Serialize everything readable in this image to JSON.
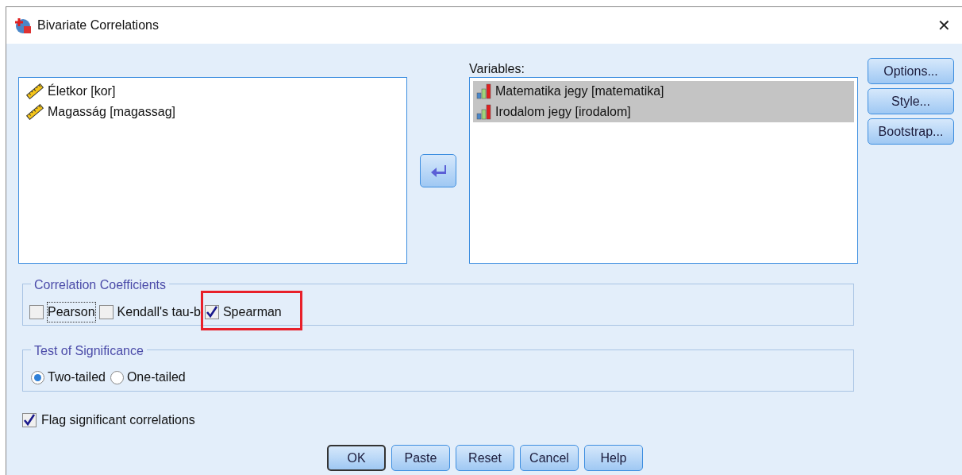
{
  "window": {
    "title": "Bivariate Correlations",
    "close": "✕"
  },
  "source_list": {
    "items": [
      {
        "label": "Életkor [kor]",
        "kind": "scale",
        "selected": false
      },
      {
        "label": "Magasság [magassag]",
        "kind": "scale",
        "selected": false
      }
    ]
  },
  "variables": {
    "label": "Variables:",
    "items": [
      {
        "label": "Matematika jegy [matematika]",
        "kind": "ordinal",
        "selected": true
      },
      {
        "label": "Irodalom jegy [irodalom]",
        "kind": "ordinal",
        "selected": true
      }
    ]
  },
  "side_buttons": [
    "Options...",
    "Style...",
    "Bootstrap..."
  ],
  "correlation_coefficients": {
    "title": "Correlation Coefficients",
    "options": [
      {
        "label": "Pearson",
        "checked": false,
        "focused": true,
        "highlighted": false
      },
      {
        "label": "Kendall's tau-b",
        "checked": false,
        "focused": false,
        "highlighted": false
      },
      {
        "label": "Spearman",
        "checked": true,
        "focused": false,
        "highlighted": true
      }
    ]
  },
  "test_of_significance": {
    "title": "Test of Significance",
    "options": [
      {
        "label": "Two-tailed",
        "selected": true
      },
      {
        "label": "One-tailed",
        "selected": false
      }
    ]
  },
  "flag_significant": {
    "label": "Flag significant correlations",
    "checked": true
  },
  "buttons": [
    {
      "label": "OK",
      "default": true
    },
    {
      "label": "Paste",
      "default": false
    },
    {
      "label": "Reset",
      "default": false
    },
    {
      "label": "Cancel",
      "default": false
    },
    {
      "label": "Help",
      "default": false
    }
  ]
}
